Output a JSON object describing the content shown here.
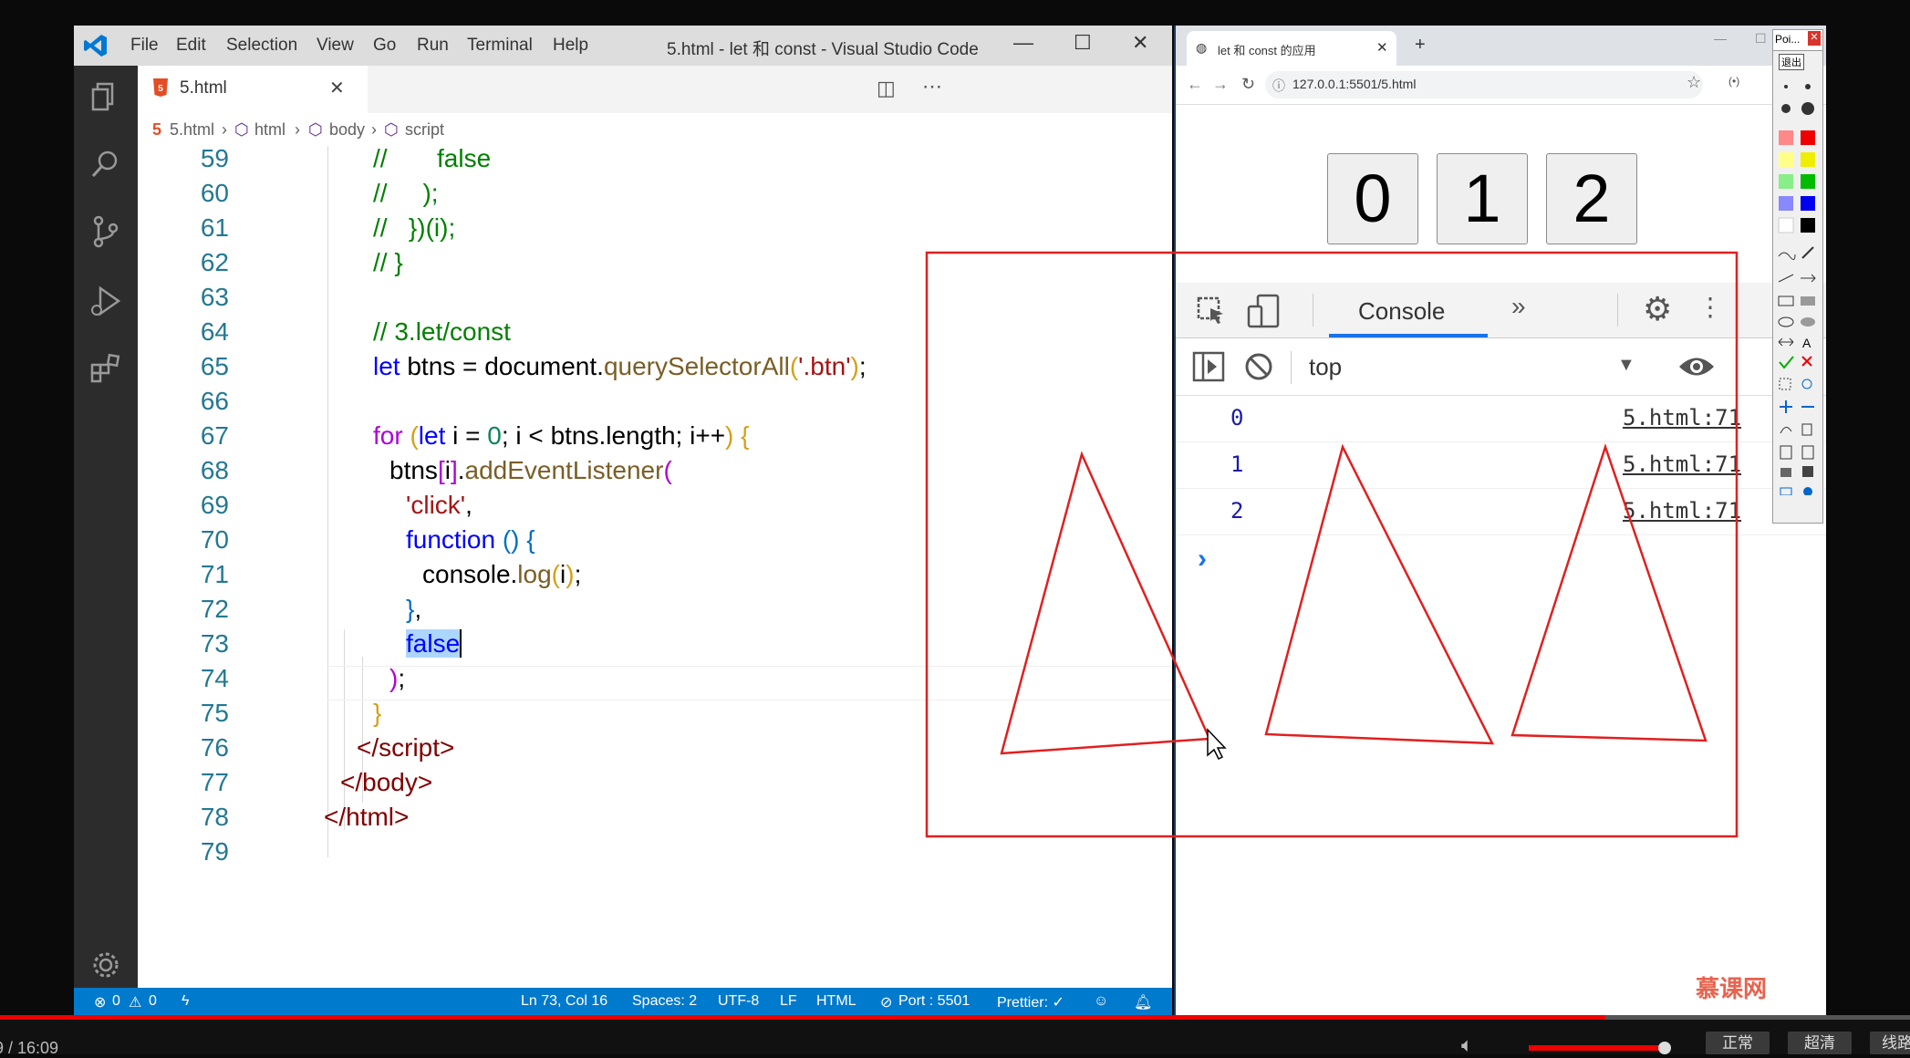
{
  "vscode": {
    "menu": [
      "File",
      "Edit",
      "Selection",
      "View",
      "Go",
      "Run",
      "Terminal",
      "Help"
    ],
    "window_title": "5.html - let 和 const - Visual Studio Code",
    "tab_label": "5.html",
    "breadcrumb": [
      "5.html",
      "html",
      "body",
      "script"
    ],
    "status": {
      "errors": "0",
      "warnings": "0",
      "position": "Ln 73, Col 16",
      "spaces": "Spaces: 2",
      "encoding": "UTF-8",
      "eol": "LF",
      "language": "HTML",
      "port": "Port : 5501",
      "prettier": "Prettier: ✓"
    }
  },
  "browser": {
    "tab_title": "let 和 const 的应用",
    "url": "127.0.0.1:5501/5.html",
    "buttons": [
      "0",
      "1",
      "2"
    ],
    "devtools": {
      "tab": "Console",
      "context": "top",
      "logs": [
        {
          "value": "0",
          "source": "5.html:71"
        },
        {
          "value": "1",
          "source": "5.html:71"
        },
        {
          "value": "2",
          "source": "5.html:71"
        }
      ],
      "prompt": "›"
    }
  },
  "paint": {
    "title": "Poi...",
    "exit": "退出"
  },
  "watermark": "慕课网",
  "video": {
    "time": "9 / 16:09",
    "speed": "正常",
    "quality": "超清",
    "line": "线路"
  },
  "colors": {
    "annotation": "#e02020",
    "vscode_status": "#007acc"
  }
}
